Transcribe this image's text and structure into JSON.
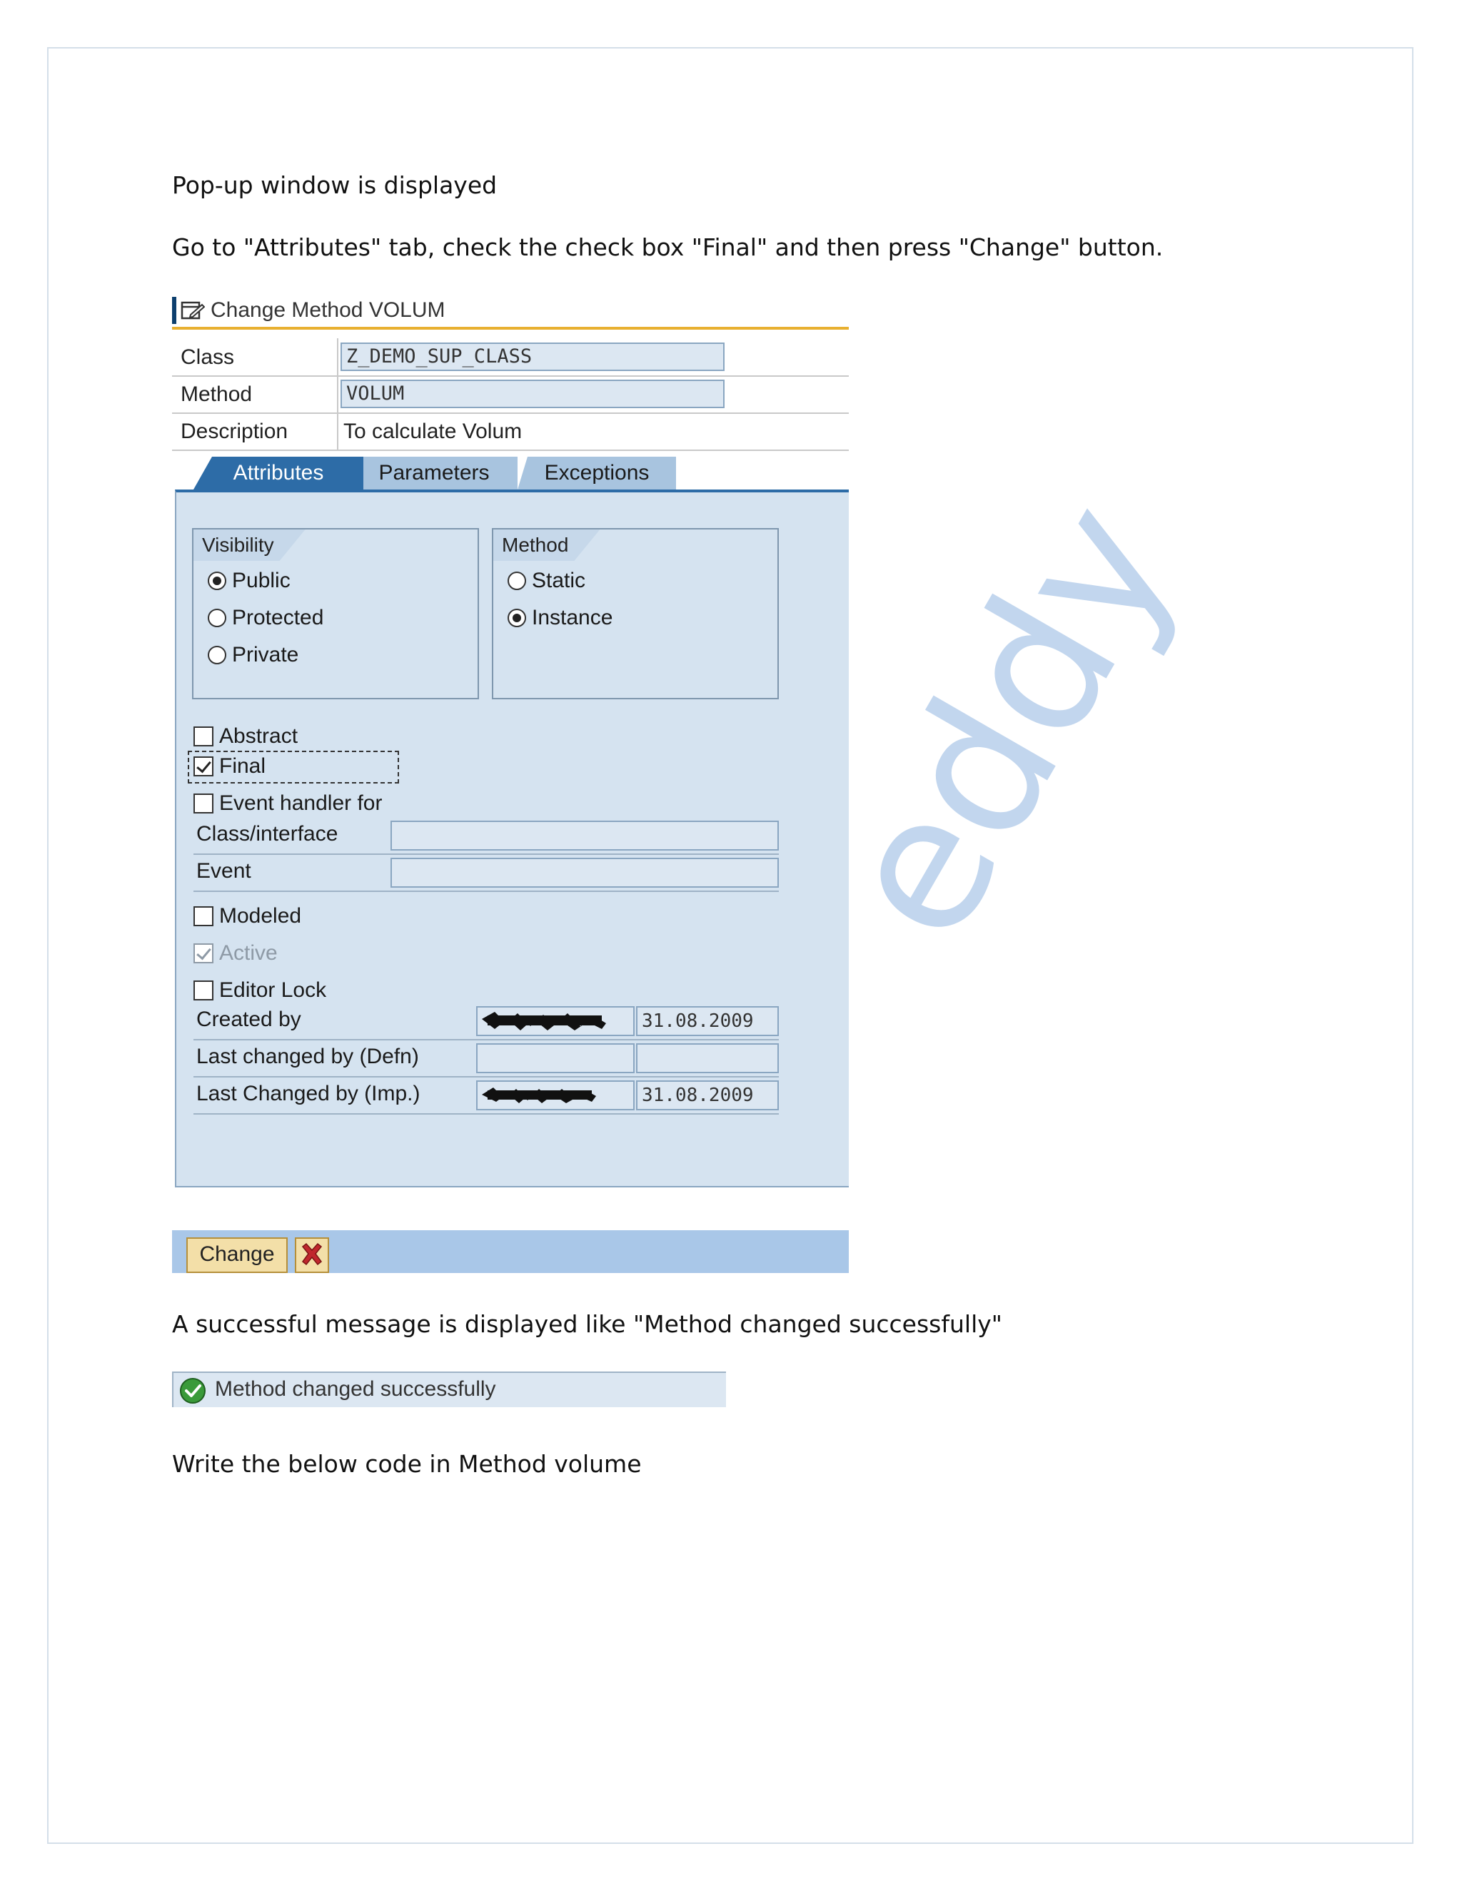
{
  "doc": {
    "para1": "Pop-up window is displayed",
    "para2": "Go to \"Attributes\" tab, check the check box \"Final\" and then press \"Change\" button.",
    "para3": "A successful message is displayed like \"Method changed successfully\"",
    "para4": "Write the below code in Method volume",
    "watermark": "eddy"
  },
  "dialog": {
    "title": "Change Method VOLUM",
    "header": {
      "class_label": "Class",
      "class_value": "Z_DEMO_SUP_CLASS",
      "method_label": "Method",
      "method_value": "VOLUM",
      "description_label": "Description",
      "description_value": "To calculate Volum"
    },
    "tabs": [
      {
        "label": "Attributes",
        "active": true
      },
      {
        "label": "Parameters",
        "active": false
      },
      {
        "label": "Exceptions",
        "active": false
      }
    ],
    "visibility": {
      "title": "Visibility",
      "options": [
        {
          "label": "Public",
          "selected": true
        },
        {
          "label": "Protected",
          "selected": false
        },
        {
          "label": "Private",
          "selected": false
        }
      ]
    },
    "method_group": {
      "title": "Method",
      "options": [
        {
          "label": "Static",
          "selected": false
        },
        {
          "label": "Instance",
          "selected": true
        }
      ]
    },
    "checkboxes": {
      "abstract": {
        "label": "Abstract",
        "checked": false
      },
      "final": {
        "label": "Final",
        "checked": true
      },
      "event_handler": {
        "label": "Event handler for",
        "checked": false
      },
      "modeled": {
        "label": "Modeled",
        "checked": false
      },
      "active": {
        "label": "Active",
        "checked": true,
        "disabled": true
      },
      "editor_lock": {
        "label": "Editor Lock",
        "checked": false
      }
    },
    "fields": {
      "class_interface_label": "Class/interface",
      "class_interface_value": "",
      "event_label": "Event",
      "event_value": "",
      "created_by_label": "Created by",
      "created_by_date": "31.08.2009",
      "last_changed_defn_label": "Last changed by (Defn)",
      "last_changed_defn_date": "",
      "last_changed_imp_label": "Last Changed by (Imp.)",
      "last_changed_imp_date": "31.08.2009"
    },
    "buttons": {
      "change_label": "Change"
    }
  },
  "status": {
    "message": "Method changed successfully"
  },
  "colors": {
    "tab_active": "#2d6ca7",
    "panel_bg": "#d5e3f0",
    "footer_bg": "#a9c7e8",
    "button_bg": "#f3dfa8",
    "cancel_red": "#c0272d",
    "success_green": "#3a9a3a",
    "watermark": "#a9c6e8"
  }
}
